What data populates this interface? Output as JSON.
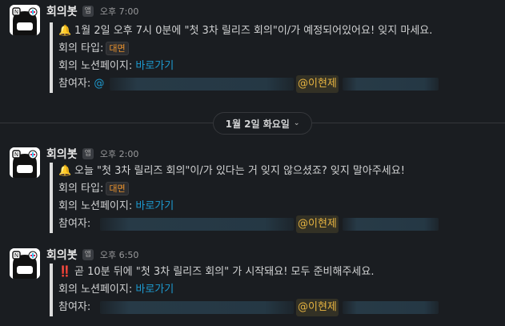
{
  "day_divider": {
    "label": "1월 2일 화요일",
    "chevron": "chevron-down-icon"
  },
  "messages": [
    {
      "sender": "회의봇",
      "badge": "앱",
      "time": "오후 7:00",
      "emoji": "🔔",
      "lines": [
        "1월 2일 오후 7시 0분에 \"첫 3차 릴리즈 회의\"이/가 예정되어있어요! 잊지 마세요."
      ],
      "type_label": "회의 타입:",
      "type_value": "대면",
      "notion_label": "회의 노션페이지:",
      "notion_link": "바로가기",
      "participants_label": "참여자:",
      "participants_prefix": "@",
      "mention": "@이현제"
    },
    {
      "sender": "회의봇",
      "badge": "앱",
      "time": "오후 2:00",
      "emoji": "🔔",
      "lines": [
        "오늘 \"첫 3차 릴리즈 회의\"이/가 있다는 거 잊지 않으셨죠? 잊지 말아주세요!"
      ],
      "type_label": "회의 타입:",
      "type_value": "대면",
      "notion_label": "회의 노션페이지:",
      "notion_link": "바로가기",
      "participants_label": "참여자:",
      "mention": "@이현제"
    },
    {
      "sender": "회의봇",
      "badge": "앱",
      "time": "오후 6:50",
      "emoji": "‼️",
      "lines": [
        "곧 10분 뒤에 \"첫 3차 릴리즈 회의\" 가 시작돼요! 모두 준비해주세요."
      ],
      "notion_label": "회의 노션페이지:",
      "notion_link": "바로가기",
      "participants_label": "참여자:",
      "mention": "@이현제"
    }
  ],
  "colors": {
    "background": "#1a1d21",
    "link": "#1d9bd1",
    "mention": "#e8b541",
    "tag": "#e8912d",
    "attachment_bar": "#dddddd"
  }
}
